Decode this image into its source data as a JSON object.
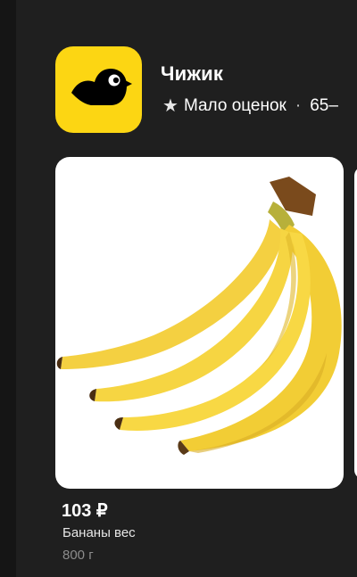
{
  "store": {
    "name": "Чижик",
    "rating_label": "Мало оценок",
    "separator": "·",
    "delivery_time": "65–",
    "logo_icon": "bird-icon",
    "logo_bg": "#fcd613"
  },
  "product": {
    "price": "103 ₽",
    "name": "Бананы вес",
    "weight": "800 г",
    "image_icon": "bananas-image"
  },
  "colors": {
    "background": "#1f1f1f",
    "card": "#ffffff",
    "accent": "#fcd613"
  }
}
